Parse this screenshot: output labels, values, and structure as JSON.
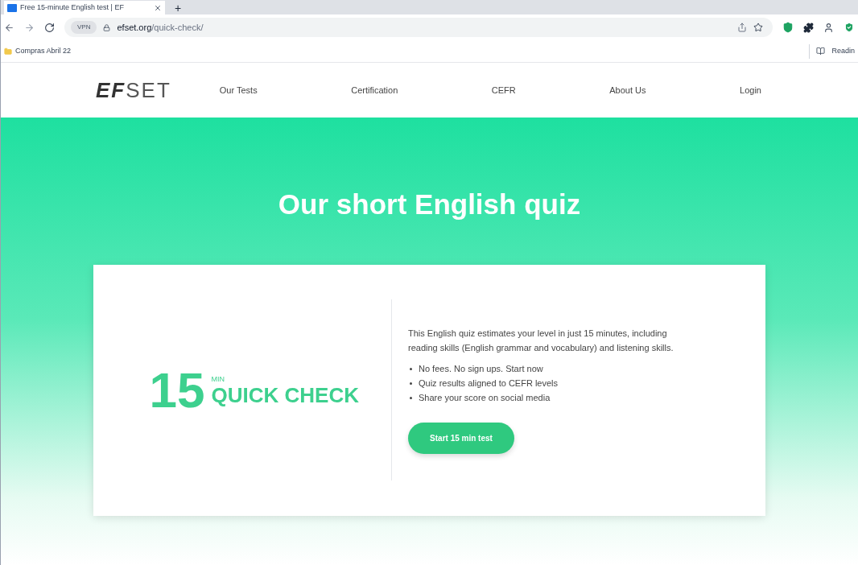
{
  "browser": {
    "tab_title": "Free 15-minute English test | EF",
    "new_tab": "+",
    "vpn_badge": "VPN",
    "url_host": "efset.org",
    "url_path": "/quick-check/",
    "bookmark": "Compras Abril 22",
    "reading_list": "Readin"
  },
  "site": {
    "logo_bold": "EF",
    "logo_light": "SET",
    "nav": [
      {
        "label": "Our Tests"
      },
      {
        "label": "Certification"
      },
      {
        "label": "CEFR"
      },
      {
        "label": "About Us"
      },
      {
        "label": "Login"
      }
    ]
  },
  "hero": {
    "title": "Our short English quiz"
  },
  "card": {
    "number": "15",
    "unit": "MIN",
    "name": "QUICK CHECK",
    "description": "This English quiz estimates your level in just 15 minutes, including reading skills (English grammar and vocabulary) and listening skills.",
    "bullets": [
      "No fees. No sign ups. Start now",
      "Quiz results aligned to CEFR levels",
      "Share your score on social media"
    ],
    "button": "Start 15 min test"
  }
}
